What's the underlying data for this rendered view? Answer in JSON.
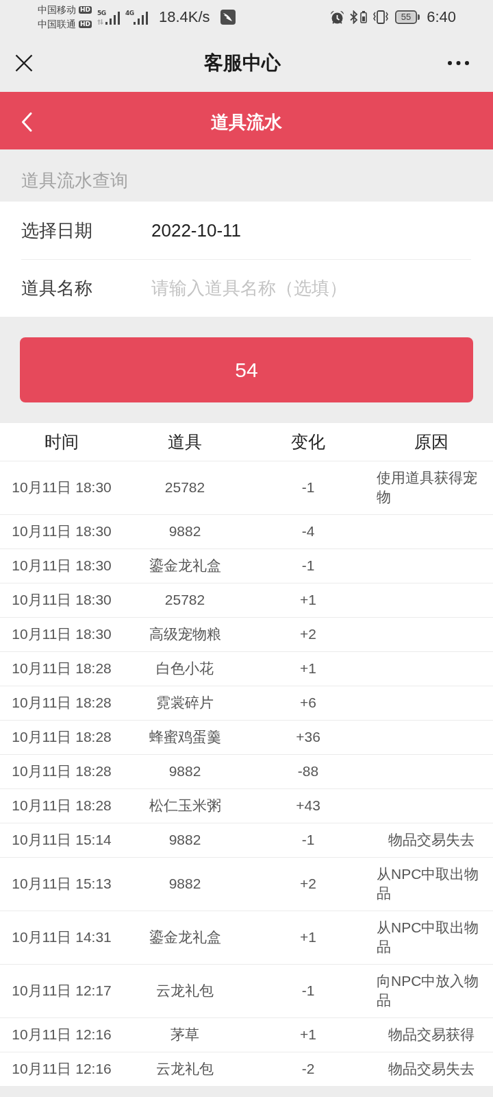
{
  "status_bar": {
    "carriers": [
      {
        "name": "中国移动",
        "badge": "HD"
      },
      {
        "name": "中国联通",
        "badge": "HD"
      }
    ],
    "networks": [
      {
        "type": "5G",
        "activity": true
      },
      {
        "type": "4G",
        "activity": false
      }
    ],
    "net_speed": "18.4K/s",
    "battery": "55",
    "time": "6:40"
  },
  "nav_bar": {
    "title": "客服中心"
  },
  "header": {
    "title": "道具流水"
  },
  "section_title": "道具流水查询",
  "form": {
    "fields": [
      {
        "label": "选择日期",
        "value": "2022-10-11"
      },
      {
        "label": "道具名称",
        "placeholder": "请输入道具名称（选填）"
      }
    ]
  },
  "submit_button": "54",
  "table": {
    "columns": [
      "时间",
      "道具",
      "变化",
      "原因"
    ],
    "rows": [
      {
        "time": "10月11日 18:30",
        "item": "25782",
        "change": "-1",
        "reason": "使用道具获得宠物"
      },
      {
        "time": "10月11日 18:30",
        "item": "9882",
        "change": "-4"
      },
      {
        "time": "10月11日 18:30",
        "item": "鎏金龙礼盒",
        "change": "-1"
      },
      {
        "time": "10月11日 18:30",
        "item": "25782",
        "change": "+1"
      },
      {
        "time": "10月11日 18:30",
        "item": "高级宠物粮",
        "change": "+2"
      },
      {
        "time": "10月11日 18:28",
        "item": "白色小花",
        "change": "+1"
      },
      {
        "time": "10月11日 18:28",
        "item": "霓裳碎片",
        "change": "+6"
      },
      {
        "time": "10月11日 18:28",
        "item": "蜂蜜鸡蛋羹",
        "change": "+36"
      },
      {
        "time": "10月11日 18:28",
        "item": "9882",
        "change": "-88"
      },
      {
        "time": "10月11日 18:28",
        "item": "松仁玉米粥",
        "change": "+43"
      },
      {
        "time": "10月11日 15:14",
        "item": "9882",
        "change": "-1",
        "reason": "物品交易失去"
      },
      {
        "time": "10月11日 15:13",
        "item": "9882",
        "change": "+2",
        "reason": "从NPC中取出物品"
      },
      {
        "time": "10月11日 14:31",
        "item": "鎏金龙礼盒",
        "change": "+1",
        "reason": "从NPC中取出物品"
      },
      {
        "time": "10月11日 12:17",
        "item": "云龙礼包",
        "change": "-1",
        "reason": "向NPC中放入物品"
      },
      {
        "time": "10月11日 12:16",
        "item": "茅草",
        "change": "+1",
        "reason": "物品交易获得"
      },
      {
        "time": "10月11日 12:16",
        "item": "云龙礼包",
        "change": "-2",
        "reason": "物品交易失去"
      }
    ]
  }
}
